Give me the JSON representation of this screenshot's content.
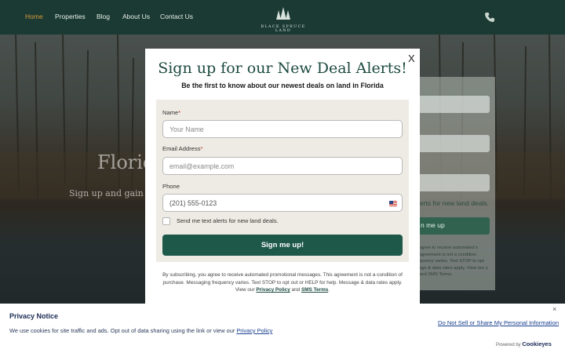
{
  "nav": {
    "items": [
      "Home",
      "Properties",
      "Blog",
      "About Us",
      "Contact Us"
    ],
    "active": "Home",
    "logo_text": "BLACK SPRUCE LAND",
    "phone_icon": "phone-icon"
  },
  "hero": {
    "title": "Floric",
    "subtitle": "Sign up and gain exc"
  },
  "background_form": {
    "alert_text": "erts for new land deals.",
    "button_label": "n me up",
    "small_text": "agree to receive automated s agreement is not a condition quency varies. Text STOP to opt age & data rates apply. View our y and SMS Terms."
  },
  "modal": {
    "close_label": "X",
    "title": "Sign up for our New Deal Alerts!",
    "subtitle": "Be the first to know about our newest deals on land in Florida",
    "name_label": "Name",
    "name_placeholder": "Your Name",
    "email_label": "Email Address",
    "email_placeholder": "email@example.com",
    "phone_label": "Phone",
    "phone_placeholder": "(201) 555-0123",
    "required_mark": "*",
    "checkbox_label": "Send me text alerts for new land deals.",
    "submit_label": "Sign me up!",
    "disclaimer_pre": "By subscribing, you agree to receive automated promotional messages. This agreement is not a condition of purchase. Messaging frequency varies. Text STOP to opt out or HELP for help. Message & data rates apply. View our",
    "privacy_link": "Privacy Policy",
    "and": "and",
    "sms_link": "SMS Terms",
    "period": "."
  },
  "privacy_banner": {
    "title": "Privacy Notice",
    "text": "We use cookies for site traffic and ads. Opt out of data sharing using the link or view our",
    "policy_link": "Privacy Policy",
    "do_not_sell": "Do Not Sell or Share My Personal Information",
    "close_label": "×",
    "powered_by": "Powered by",
    "brand": "Cookieyes"
  },
  "colors": {
    "nav_bg": "#1a3a33",
    "nav_active": "#d79a3c",
    "brand_green": "#1e5848",
    "title_green": "#1d4a40",
    "form_box": "#eeebe4"
  }
}
